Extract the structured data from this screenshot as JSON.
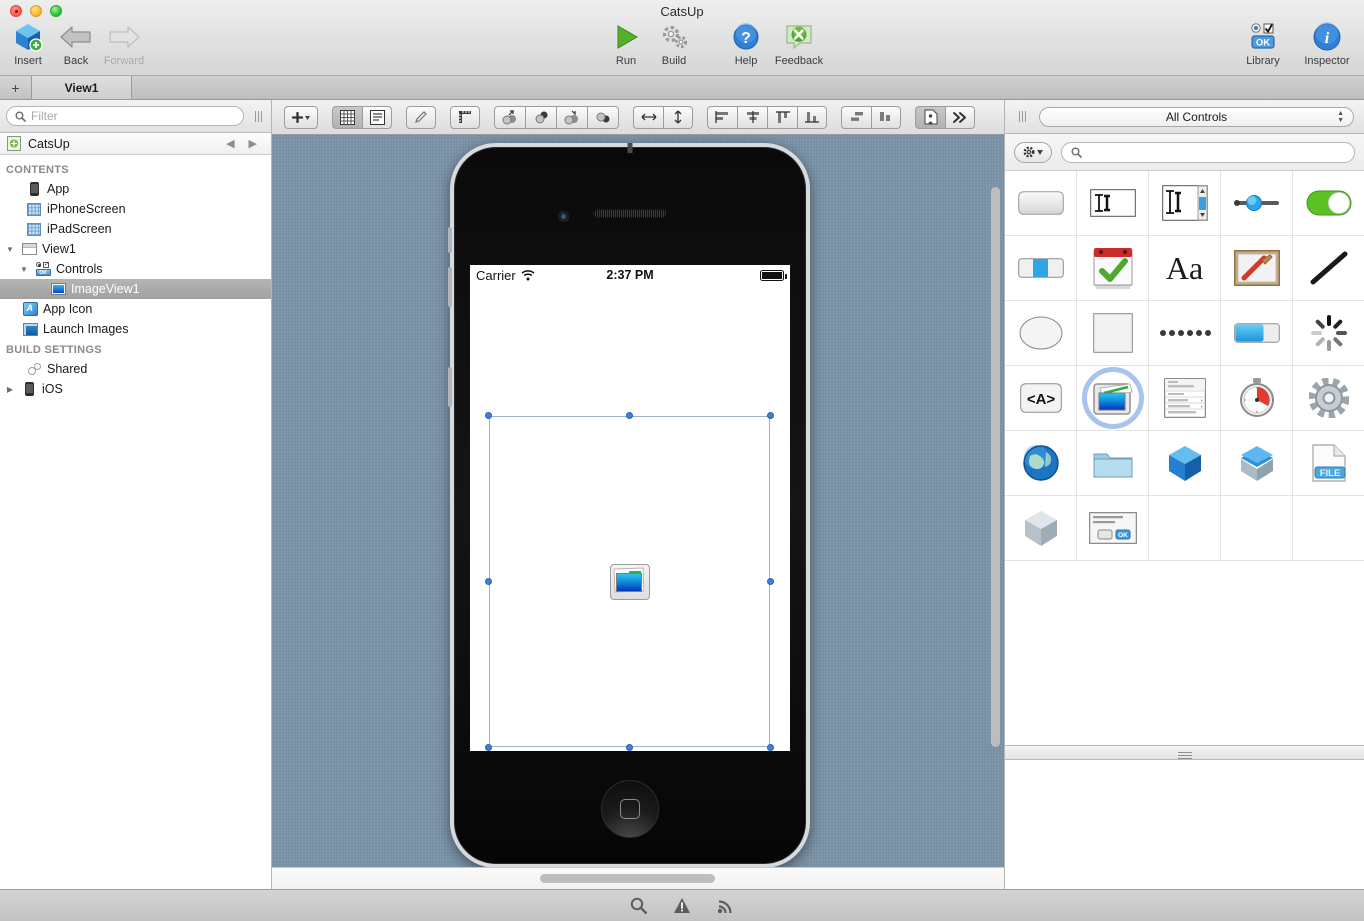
{
  "window": {
    "title": "CatsUp",
    "traffic_lights": [
      "close",
      "minimize",
      "zoom"
    ]
  },
  "toolbar": {
    "left_items": [
      {
        "label": "Insert",
        "icon": "cube-add-icon",
        "enabled": true
      },
      {
        "label": "Back",
        "icon": "arrow-left-icon",
        "enabled": true
      },
      {
        "label": "Forward",
        "icon": "arrow-right-icon",
        "enabled": false
      }
    ],
    "center_items": [
      {
        "label": "Run",
        "icon": "play-icon",
        "enabled": true
      },
      {
        "label": "Build",
        "icon": "gears-icon",
        "enabled": true
      }
    ],
    "help_items": [
      {
        "label": "Help",
        "icon": "question-circle-icon",
        "enabled": true
      },
      {
        "label": "Feedback",
        "icon": "feedback-bubble-icon",
        "enabled": true
      }
    ],
    "right_items": [
      {
        "label": "Library",
        "icon": "library-controls-icon",
        "enabled": true
      },
      {
        "label": "Inspector",
        "icon": "info-circle-icon",
        "enabled": true
      }
    ]
  },
  "tabbar": {
    "add_label": "+",
    "tabs": [
      {
        "label": "View1",
        "active": true
      }
    ]
  },
  "sidebar": {
    "filter_placeholder": "Filter",
    "project": {
      "name": "CatsUp",
      "icon": "project-icon"
    },
    "nav_back": "◀",
    "nav_forward": "▶",
    "groups": [
      {
        "title": "CONTENTS",
        "items": [
          {
            "label": "App",
            "icon": "phone-icon",
            "indent": 1,
            "twisty": "",
            "selected": false
          },
          {
            "label": "iPhoneScreen",
            "icon": "screen-grid-icon",
            "indent": 1,
            "twisty": "",
            "selected": false
          },
          {
            "label": "iPadScreen",
            "icon": "screen-grid-icon",
            "indent": 1,
            "twisty": "",
            "selected": false
          },
          {
            "label": "View1",
            "icon": "view-icon",
            "indent": 0,
            "twisty": "▼",
            "selected": false
          },
          {
            "label": "Controls",
            "icon": "controls-icon",
            "indent": 1,
            "twisty": "▼",
            "selected": false
          },
          {
            "label": "ImageView1",
            "icon": "imageview-icon",
            "indent": 3,
            "twisty": "",
            "selected": true
          },
          {
            "label": "App Icon",
            "icon": "appicon-icon",
            "indent": 1,
            "twisty": "",
            "selected": false
          },
          {
            "label": "Launch Images",
            "icon": "launchimages-icon",
            "indent": 1,
            "twisty": "",
            "selected": false
          }
        ]
      },
      {
        "title": "BUILD SETTINGS",
        "items": [
          {
            "label": "Shared",
            "icon": "shared-icon",
            "indent": 1,
            "twisty": "",
            "selected": false
          },
          {
            "label": "iOS",
            "icon": "phone-icon",
            "indent": 0,
            "twisty": "▶",
            "selected": false
          }
        ]
      }
    ]
  },
  "layout_toolbar": {
    "groups": [
      {
        "name": "add",
        "buttons": [
          {
            "icon": "plus-dropdown-icon",
            "active": false,
            "lone": true
          }
        ]
      },
      {
        "name": "view-mode",
        "buttons": [
          {
            "icon": "grid-layout-icon",
            "active": true
          },
          {
            "icon": "list-layout-icon",
            "active": false
          }
        ]
      },
      {
        "name": "draw",
        "buttons": [
          {
            "icon": "pencil-icon",
            "active": false,
            "lone": true
          }
        ]
      },
      {
        "name": "ruler",
        "buttons": [
          {
            "icon": "ruler-icon",
            "active": false,
            "lone": true
          }
        ]
      },
      {
        "name": "arrange",
        "buttons": [
          {
            "icon": "bring-to-front-icon",
            "active": false
          },
          {
            "icon": "bring-forward-icon",
            "active": false
          },
          {
            "icon": "send-backward-icon",
            "active": false
          },
          {
            "icon": "send-to-back-icon",
            "active": false
          }
        ]
      },
      {
        "name": "size",
        "buttons": [
          {
            "icon": "equal-width-icon",
            "active": false
          },
          {
            "icon": "equal-height-icon",
            "active": false
          }
        ]
      },
      {
        "name": "align",
        "buttons": [
          {
            "icon": "align-left-icon",
            "active": false
          },
          {
            "icon": "align-center-icon",
            "active": false
          },
          {
            "icon": "align-top-icon",
            "active": false
          },
          {
            "icon": "align-bottom-icon",
            "active": false
          }
        ]
      },
      {
        "name": "distribute",
        "buttons": [
          {
            "icon": "distribute-horizontal-icon",
            "active": false
          },
          {
            "icon": "distribute-vertical-icon",
            "active": false
          }
        ]
      },
      {
        "name": "overflow",
        "buttons": [
          {
            "icon": "page-layout-icon",
            "active": true
          },
          {
            "icon": "chevron-double-right-icon",
            "active": false
          }
        ]
      }
    ]
  },
  "canvas": {
    "background_color": "#7b93a8",
    "device": "iPhone",
    "status_bar": {
      "carrier": "Carrier",
      "wifi_icon": "wifi-icon",
      "time": "2:37 PM",
      "battery_icon": "battery-full-icon"
    },
    "selected_control": {
      "name": "ImageView1",
      "icon": "imageview-placeholder-icon",
      "handles": 8
    }
  },
  "library": {
    "filter_value": "All Controls",
    "filter_options": [
      "All Controls"
    ],
    "gear_icon": "gear-dropdown-icon",
    "search_placeholder": "",
    "search_icon": "search-icon",
    "controls": [
      {
        "name": "button-control",
        "icon": "rounded-button-icon",
        "selected": false
      },
      {
        "name": "textfield-control",
        "icon": "textfield-icon",
        "selected": false
      },
      {
        "name": "textarea-control",
        "icon": "textarea-scroll-icon",
        "selected": false
      },
      {
        "name": "slider-control",
        "icon": "slider-icon",
        "selected": false
      },
      {
        "name": "switch-control",
        "icon": "switch-on-icon",
        "selected": false
      },
      {
        "name": "segmented-control",
        "icon": "segmented-icon",
        "selected": false
      },
      {
        "name": "datepicker-control",
        "icon": "calendar-check-icon",
        "selected": false
      },
      {
        "name": "label-control",
        "icon": "aa-text-icon",
        "selected": false
      },
      {
        "name": "canvas-control",
        "icon": "paint-canvas-icon",
        "selected": false
      },
      {
        "name": "line-control",
        "icon": "diagonal-line-icon",
        "selected": false
      },
      {
        "name": "oval-control",
        "icon": "oval-icon",
        "selected": false
      },
      {
        "name": "rectangle-control",
        "icon": "rectangle-icon",
        "selected": false
      },
      {
        "name": "pagecontrol-control",
        "icon": "page-dots-icon",
        "selected": false
      },
      {
        "name": "progressbar-control",
        "icon": "progress-bar-icon",
        "selected": false
      },
      {
        "name": "activityindicator-control",
        "icon": "spinner-icon",
        "selected": false
      },
      {
        "name": "htmlviewer-control",
        "icon": "angle-a-icon",
        "selected": false
      },
      {
        "name": "imageview-control",
        "icon": "imageview-icon",
        "selected": true
      },
      {
        "name": "tableview-control",
        "icon": "table-rows-icon",
        "selected": false
      },
      {
        "name": "timer-control",
        "icon": "stopwatch-icon",
        "selected": false
      },
      {
        "name": "settings-control",
        "icon": "gear-wheel-icon",
        "selected": false
      },
      {
        "name": "httpsocket-control",
        "icon": "globe-icon",
        "selected": false
      },
      {
        "name": "folderitem-control",
        "icon": "folder-icon",
        "selected": false
      },
      {
        "name": "module-control",
        "icon": "blue-cube-icon",
        "selected": false
      },
      {
        "name": "container-control",
        "icon": "open-cube-icon",
        "selected": false
      },
      {
        "name": "file-control",
        "icon": "file-doc-icon",
        "selected": false
      },
      {
        "name": "class-control",
        "icon": "gray-cube-icon",
        "selected": false
      },
      {
        "name": "messagedialog-control",
        "icon": "dialog-box-icon",
        "selected": false
      }
    ]
  },
  "statusbar": {
    "items": [
      {
        "name": "search-icon",
        "label": ""
      },
      {
        "name": "warning-icon",
        "label": ""
      },
      {
        "name": "broadcast-icon",
        "label": ""
      }
    ]
  }
}
